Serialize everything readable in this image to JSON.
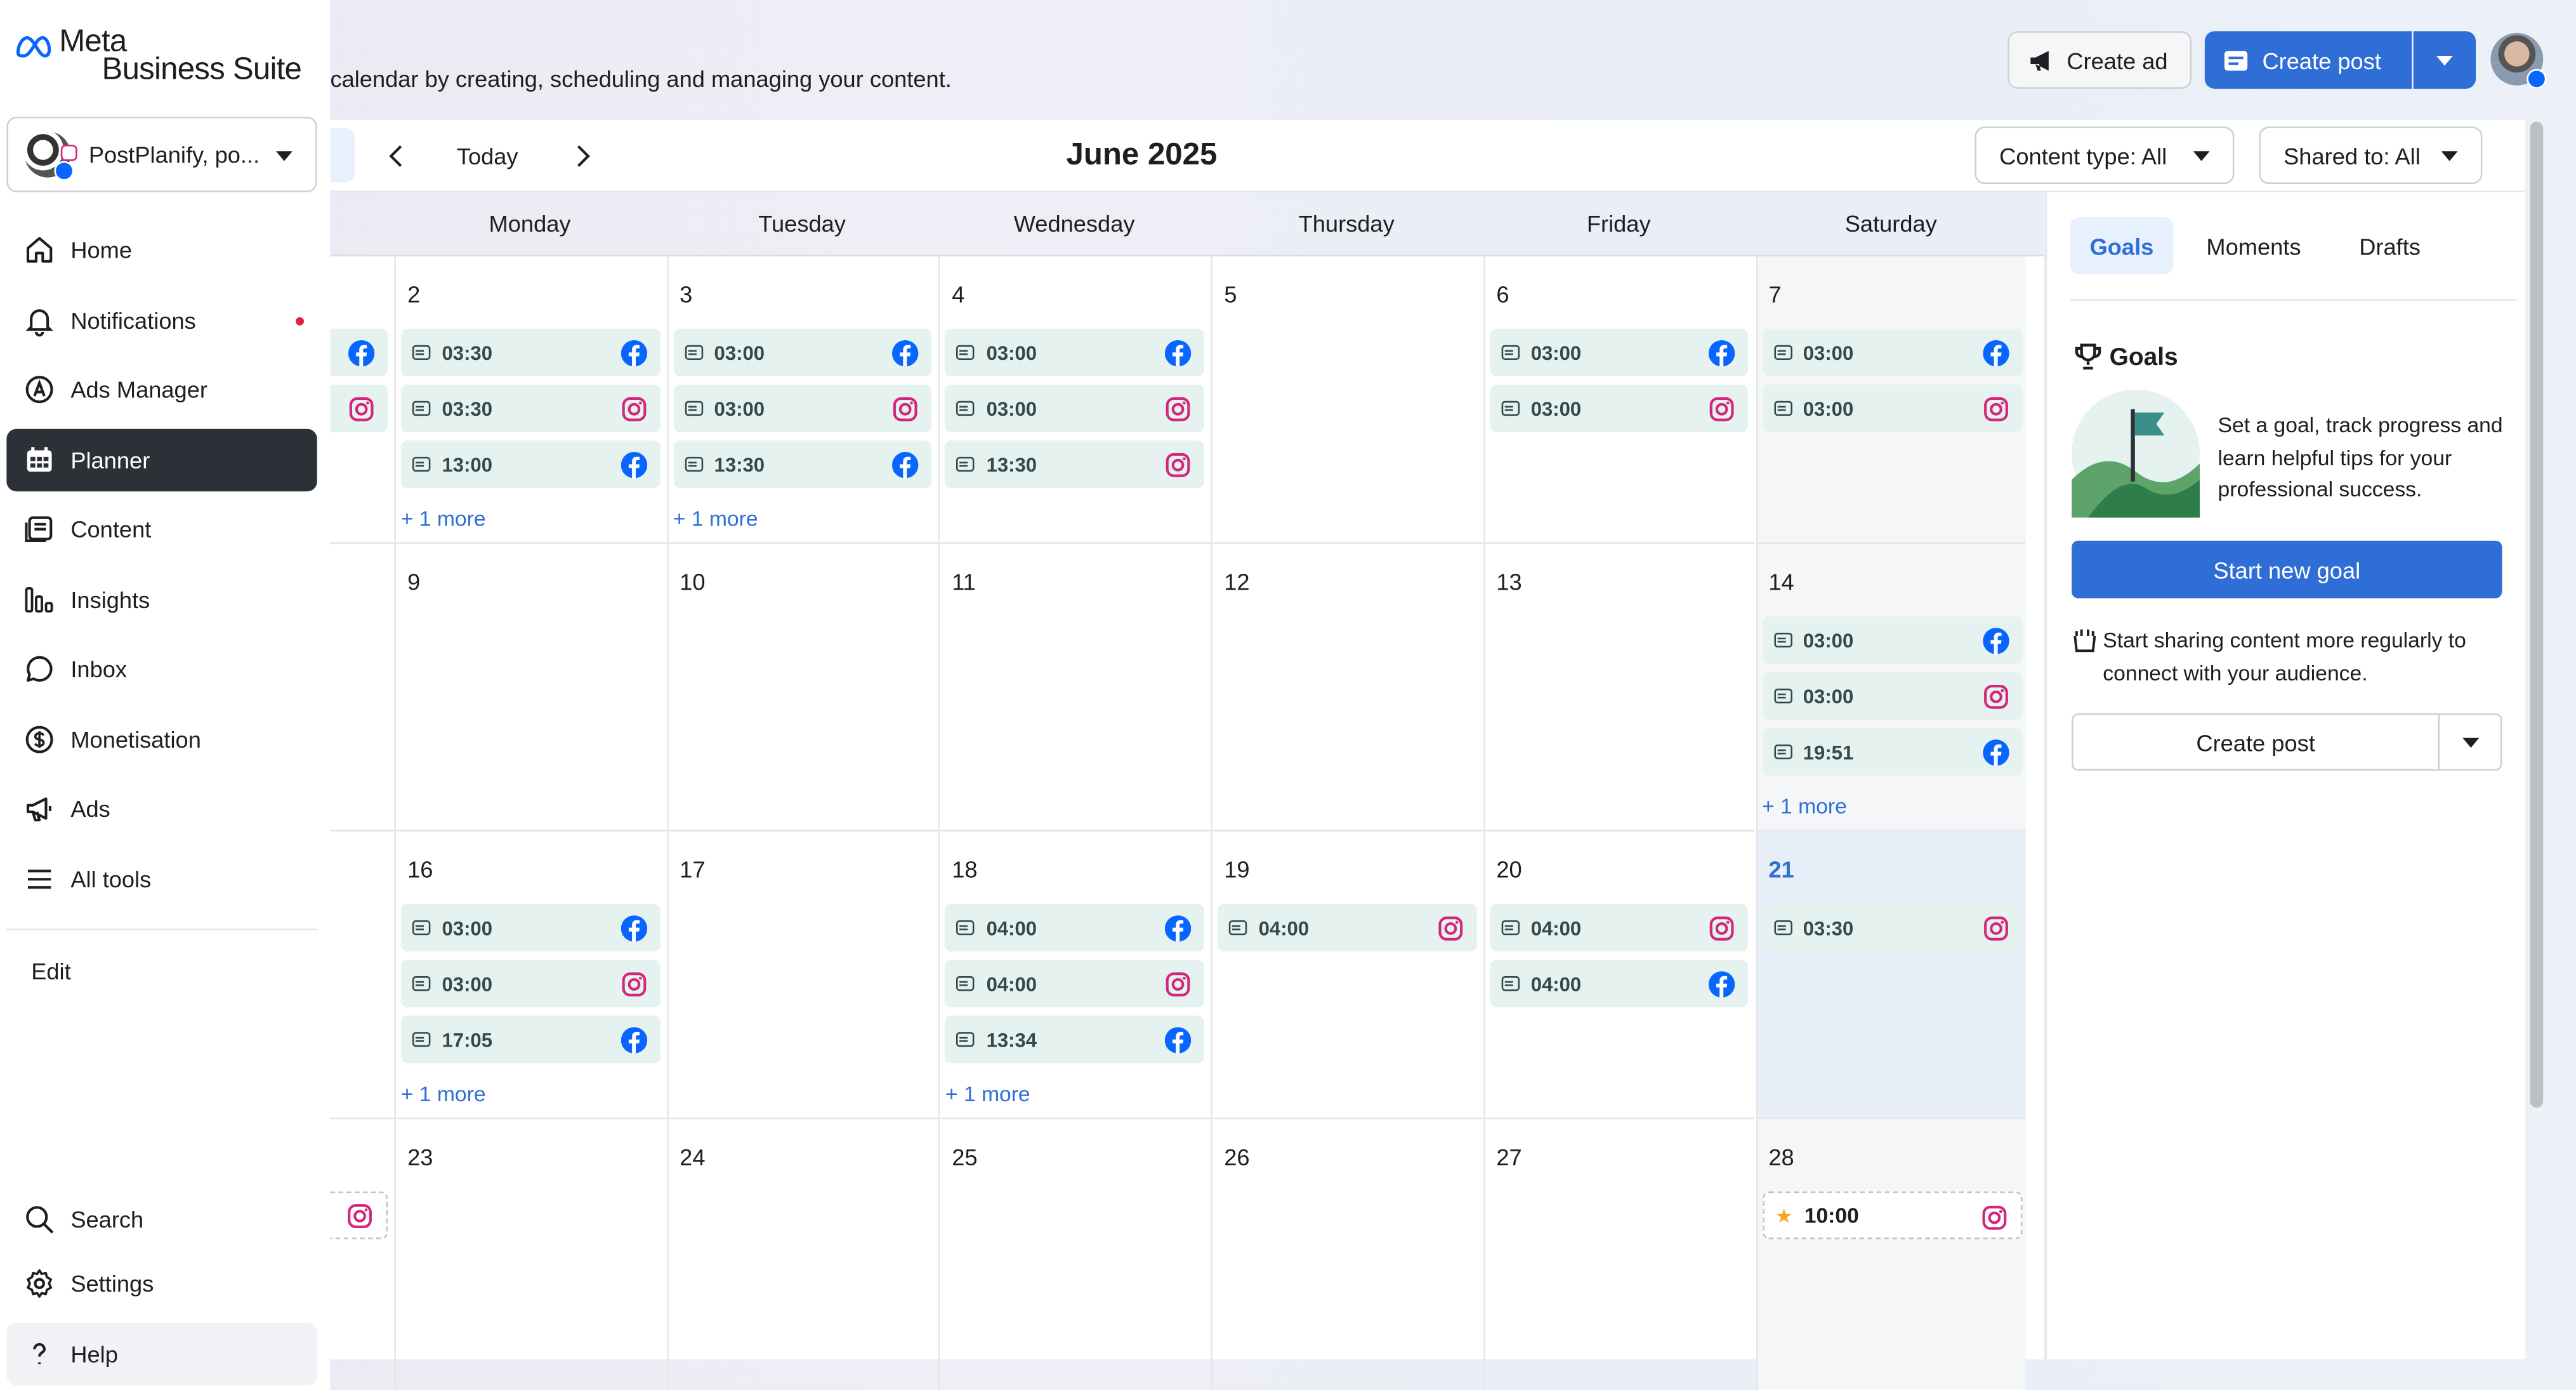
{
  "app": {
    "brand_line1": "Meta",
    "brand_line2": "Business Suite"
  },
  "account": {
    "name": "PostPlanify, po...",
    "avatar_icon": "account-avatar-icon"
  },
  "page": {
    "subtitle": "calendar by creating, scheduling and managing your content."
  },
  "sidebar": {
    "items": [
      {
        "label": "Home",
        "icon": "home-icon"
      },
      {
        "label": "Notifications",
        "icon": "bell-icon",
        "badge_dot": true
      },
      {
        "label": "Ads Manager",
        "icon": "ads-manager-icon"
      },
      {
        "label": "Planner",
        "icon": "calendar-grid-icon",
        "active": true
      },
      {
        "label": "Content",
        "icon": "content-icon"
      },
      {
        "label": "Insights",
        "icon": "insights-bars-icon"
      },
      {
        "label": "Inbox",
        "icon": "chat-bubble-icon"
      },
      {
        "label": "Monetisation",
        "icon": "dollar-icon"
      },
      {
        "label": "Ads",
        "icon": "megaphone-icon"
      },
      {
        "label": "All tools",
        "icon": "menu-lines-icon"
      }
    ],
    "edit_label": "Edit",
    "bottom": [
      {
        "label": "Search",
        "icon": "search-icon"
      },
      {
        "label": "Settings",
        "icon": "gear-icon"
      },
      {
        "label": "Help",
        "icon": "question-icon"
      }
    ]
  },
  "header": {
    "create_ad_label": "Create ad",
    "create_post_label": "Create post"
  },
  "toolbar": {
    "today_label": "Today",
    "month_title": "June 2025",
    "content_type_label": "Content type: All",
    "shared_to_label": "Shared to: All"
  },
  "weekdays": [
    "Monday",
    "Tuesday",
    "Wednesday",
    "Thursday",
    "Friday",
    "Saturday"
  ],
  "weeks": [
    {
      "days": [
        {
          "num": "2",
          "events": [
            {
              "time": "03:30",
              "net": "facebook"
            },
            {
              "time": "03:30",
              "net": "instagram"
            },
            {
              "time": "13:00",
              "net": "facebook"
            }
          ],
          "more": "+ 1 more"
        },
        {
          "num": "3",
          "events": [
            {
              "time": "03:00",
              "net": "facebook"
            },
            {
              "time": "03:00",
              "net": "instagram"
            },
            {
              "time": "13:30",
              "net": "facebook"
            }
          ],
          "more": "+ 1 more"
        },
        {
          "num": "4",
          "events": [
            {
              "time": "03:00",
              "net": "facebook"
            },
            {
              "time": "03:00",
              "net": "instagram"
            },
            {
              "time": "13:30",
              "net": "instagram"
            }
          ]
        },
        {
          "num": "5",
          "events": []
        },
        {
          "num": "6",
          "events": [
            {
              "time": "03:00",
              "net": "facebook"
            },
            {
              "time": "03:00",
              "net": "instagram"
            }
          ]
        },
        {
          "num": "7",
          "events": [
            {
              "time": "03:00",
              "net": "facebook"
            },
            {
              "time": "03:00",
              "net": "instagram"
            }
          ]
        }
      ]
    },
    {
      "days": [
        {
          "num": "9",
          "events": []
        },
        {
          "num": "10",
          "events": []
        },
        {
          "num": "11",
          "events": []
        },
        {
          "num": "12",
          "events": []
        },
        {
          "num": "13",
          "events": []
        },
        {
          "num": "14",
          "events": [
            {
              "time": "03:00",
              "net": "facebook"
            },
            {
              "time": "03:00",
              "net": "instagram"
            },
            {
              "time": "19:51",
              "net": "facebook"
            }
          ],
          "more": "+ 1 more"
        }
      ]
    },
    {
      "days": [
        {
          "num": "16",
          "events": [
            {
              "time": "03:00",
              "net": "facebook"
            },
            {
              "time": "03:00",
              "net": "instagram"
            },
            {
              "time": "17:05",
              "net": "facebook"
            }
          ],
          "more": "+ 1 more"
        },
        {
          "num": "17",
          "events": []
        },
        {
          "num": "18",
          "events": [
            {
              "time": "04:00",
              "net": "facebook"
            },
            {
              "time": "04:00",
              "net": "instagram"
            },
            {
              "time": "13:34",
              "net": "facebook"
            }
          ],
          "more": "+ 1 more"
        },
        {
          "num": "19",
          "events": [
            {
              "time": "04:00",
              "net": "instagram"
            }
          ]
        },
        {
          "num": "20",
          "events": [
            {
              "time": "04:00",
              "net": "instagram"
            },
            {
              "time": "04:00",
              "net": "facebook"
            }
          ]
        },
        {
          "num": "21",
          "today": true,
          "events": [
            {
              "time": "03:30",
              "net": "instagram"
            }
          ]
        }
      ]
    },
    {
      "days": [
        {
          "num": "23",
          "events": []
        },
        {
          "num": "24",
          "events": []
        },
        {
          "num": "25",
          "events": []
        },
        {
          "num": "26",
          "events": []
        },
        {
          "num": "27",
          "events": []
        },
        {
          "num": "28",
          "events": [
            {
              "time": "10:00",
              "net": "instagram",
              "draft": true
            }
          ]
        }
      ]
    }
  ],
  "side_panel": {
    "tabs": [
      "Goals",
      "Moments",
      "Drafts"
    ],
    "goals_title": "Goals",
    "goals_text": "Set a goal, track progress and learn helpful tips for your professional success.",
    "start_goal_label": "Start new goal",
    "share_text": "Start sharing content more regularly to connect with your audience.",
    "create_post_label": "Create post"
  },
  "colors": {
    "accent": "#2f6ed6",
    "event_bg": "#e6f2ef",
    "facebook": "#0866ff",
    "instagram": "#d3267a",
    "nav_active": "#2b3137"
  }
}
